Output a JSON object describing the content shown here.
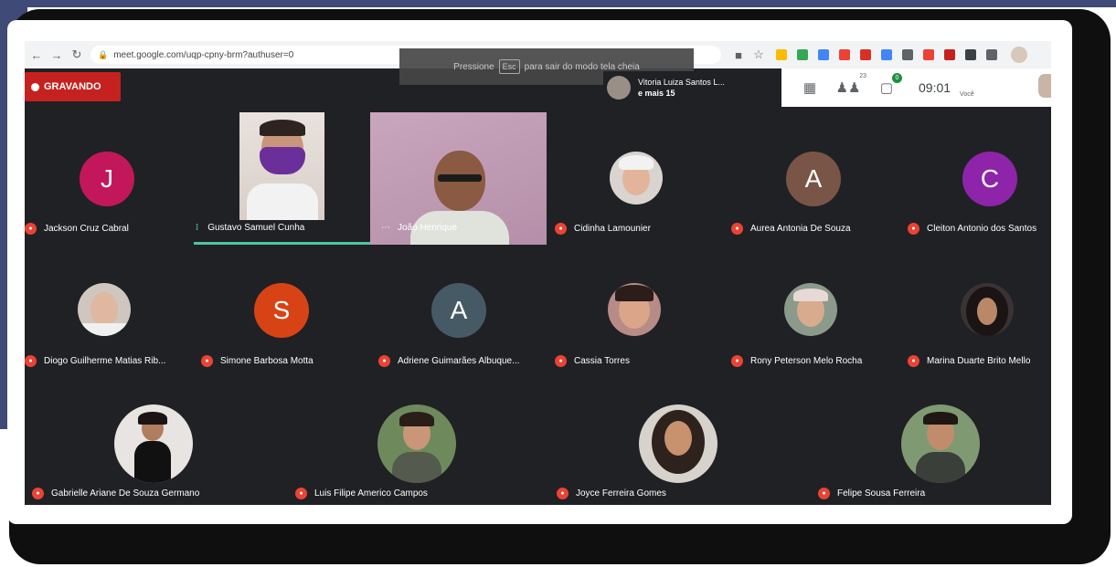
{
  "browser": {
    "url": "meet.google.com/uqp-cpny-brm?authuser=0",
    "extensions": [
      {
        "icon": "drive-icon",
        "color": "#fbbc04"
      },
      {
        "icon": "meet-icon",
        "color": "#34a853"
      },
      {
        "icon": "play-icon",
        "color": "#4285f4"
      },
      {
        "icon": "pdf-icon",
        "color": "#ea4335"
      },
      {
        "icon": "shield-icon",
        "color": "#d93025"
      },
      {
        "icon": "doc-icon",
        "color": "#4285f4"
      },
      {
        "icon": "briefcase-icon",
        "color": "#5f6368"
      },
      {
        "icon": "diamond-icon",
        "color": "#ea4335"
      },
      {
        "icon": "pen-icon",
        "color": "#c5221f"
      },
      {
        "icon": "square-icon",
        "color": "#3c4043"
      },
      {
        "icon": "puzzle-icon",
        "color": "#5f6368"
      }
    ]
  },
  "fullscreen_hint": {
    "pre": "Pressione",
    "key": "Esc",
    "post": "para sair do modo tela cheia"
  },
  "recording": {
    "label": "GRAVANDO"
  },
  "presenter": {
    "name": "Vitoria Luiza Santos L...",
    "extra": "e mais 15"
  },
  "toolbar": {
    "people_count": "23",
    "chat_count": "0",
    "time": "09:01",
    "you_label": "Você"
  },
  "participants": [
    {
      "name": "Jackson Cruz Cabral",
      "initial": "J",
      "color": "#c2185b"
    },
    {
      "name": "Gustavo Samuel Cunha"
    },
    {
      "name": "João Henrique"
    },
    {
      "name": "Cidinha Lamounier"
    },
    {
      "name": "Aurea Antonia De Souza",
      "initial": "A",
      "color": "#795548"
    },
    {
      "name": "Cleiton Antonio dos Santos",
      "initial": "C",
      "color": "#8e24aa"
    },
    {
      "name": "Diogo Guilherme Matias Rib..."
    },
    {
      "name": "Simone Barbosa Motta",
      "initial": "S",
      "color": "#d84315"
    },
    {
      "name": "Adriene Guimarães Albuque...",
      "initial": "A",
      "color": "#455a64"
    },
    {
      "name": "Cassia Torres"
    },
    {
      "name": "Rony Peterson Melo Rocha"
    },
    {
      "name": "Marina Duarte Brito Mello"
    },
    {
      "name": "Gabrielle Ariane De Souza Germano"
    },
    {
      "name": "Luis Filipe Americo Campos"
    },
    {
      "name": "Joyce Ferreira Gomes"
    },
    {
      "name": "Felipe Sousa Ferreira"
    }
  ]
}
